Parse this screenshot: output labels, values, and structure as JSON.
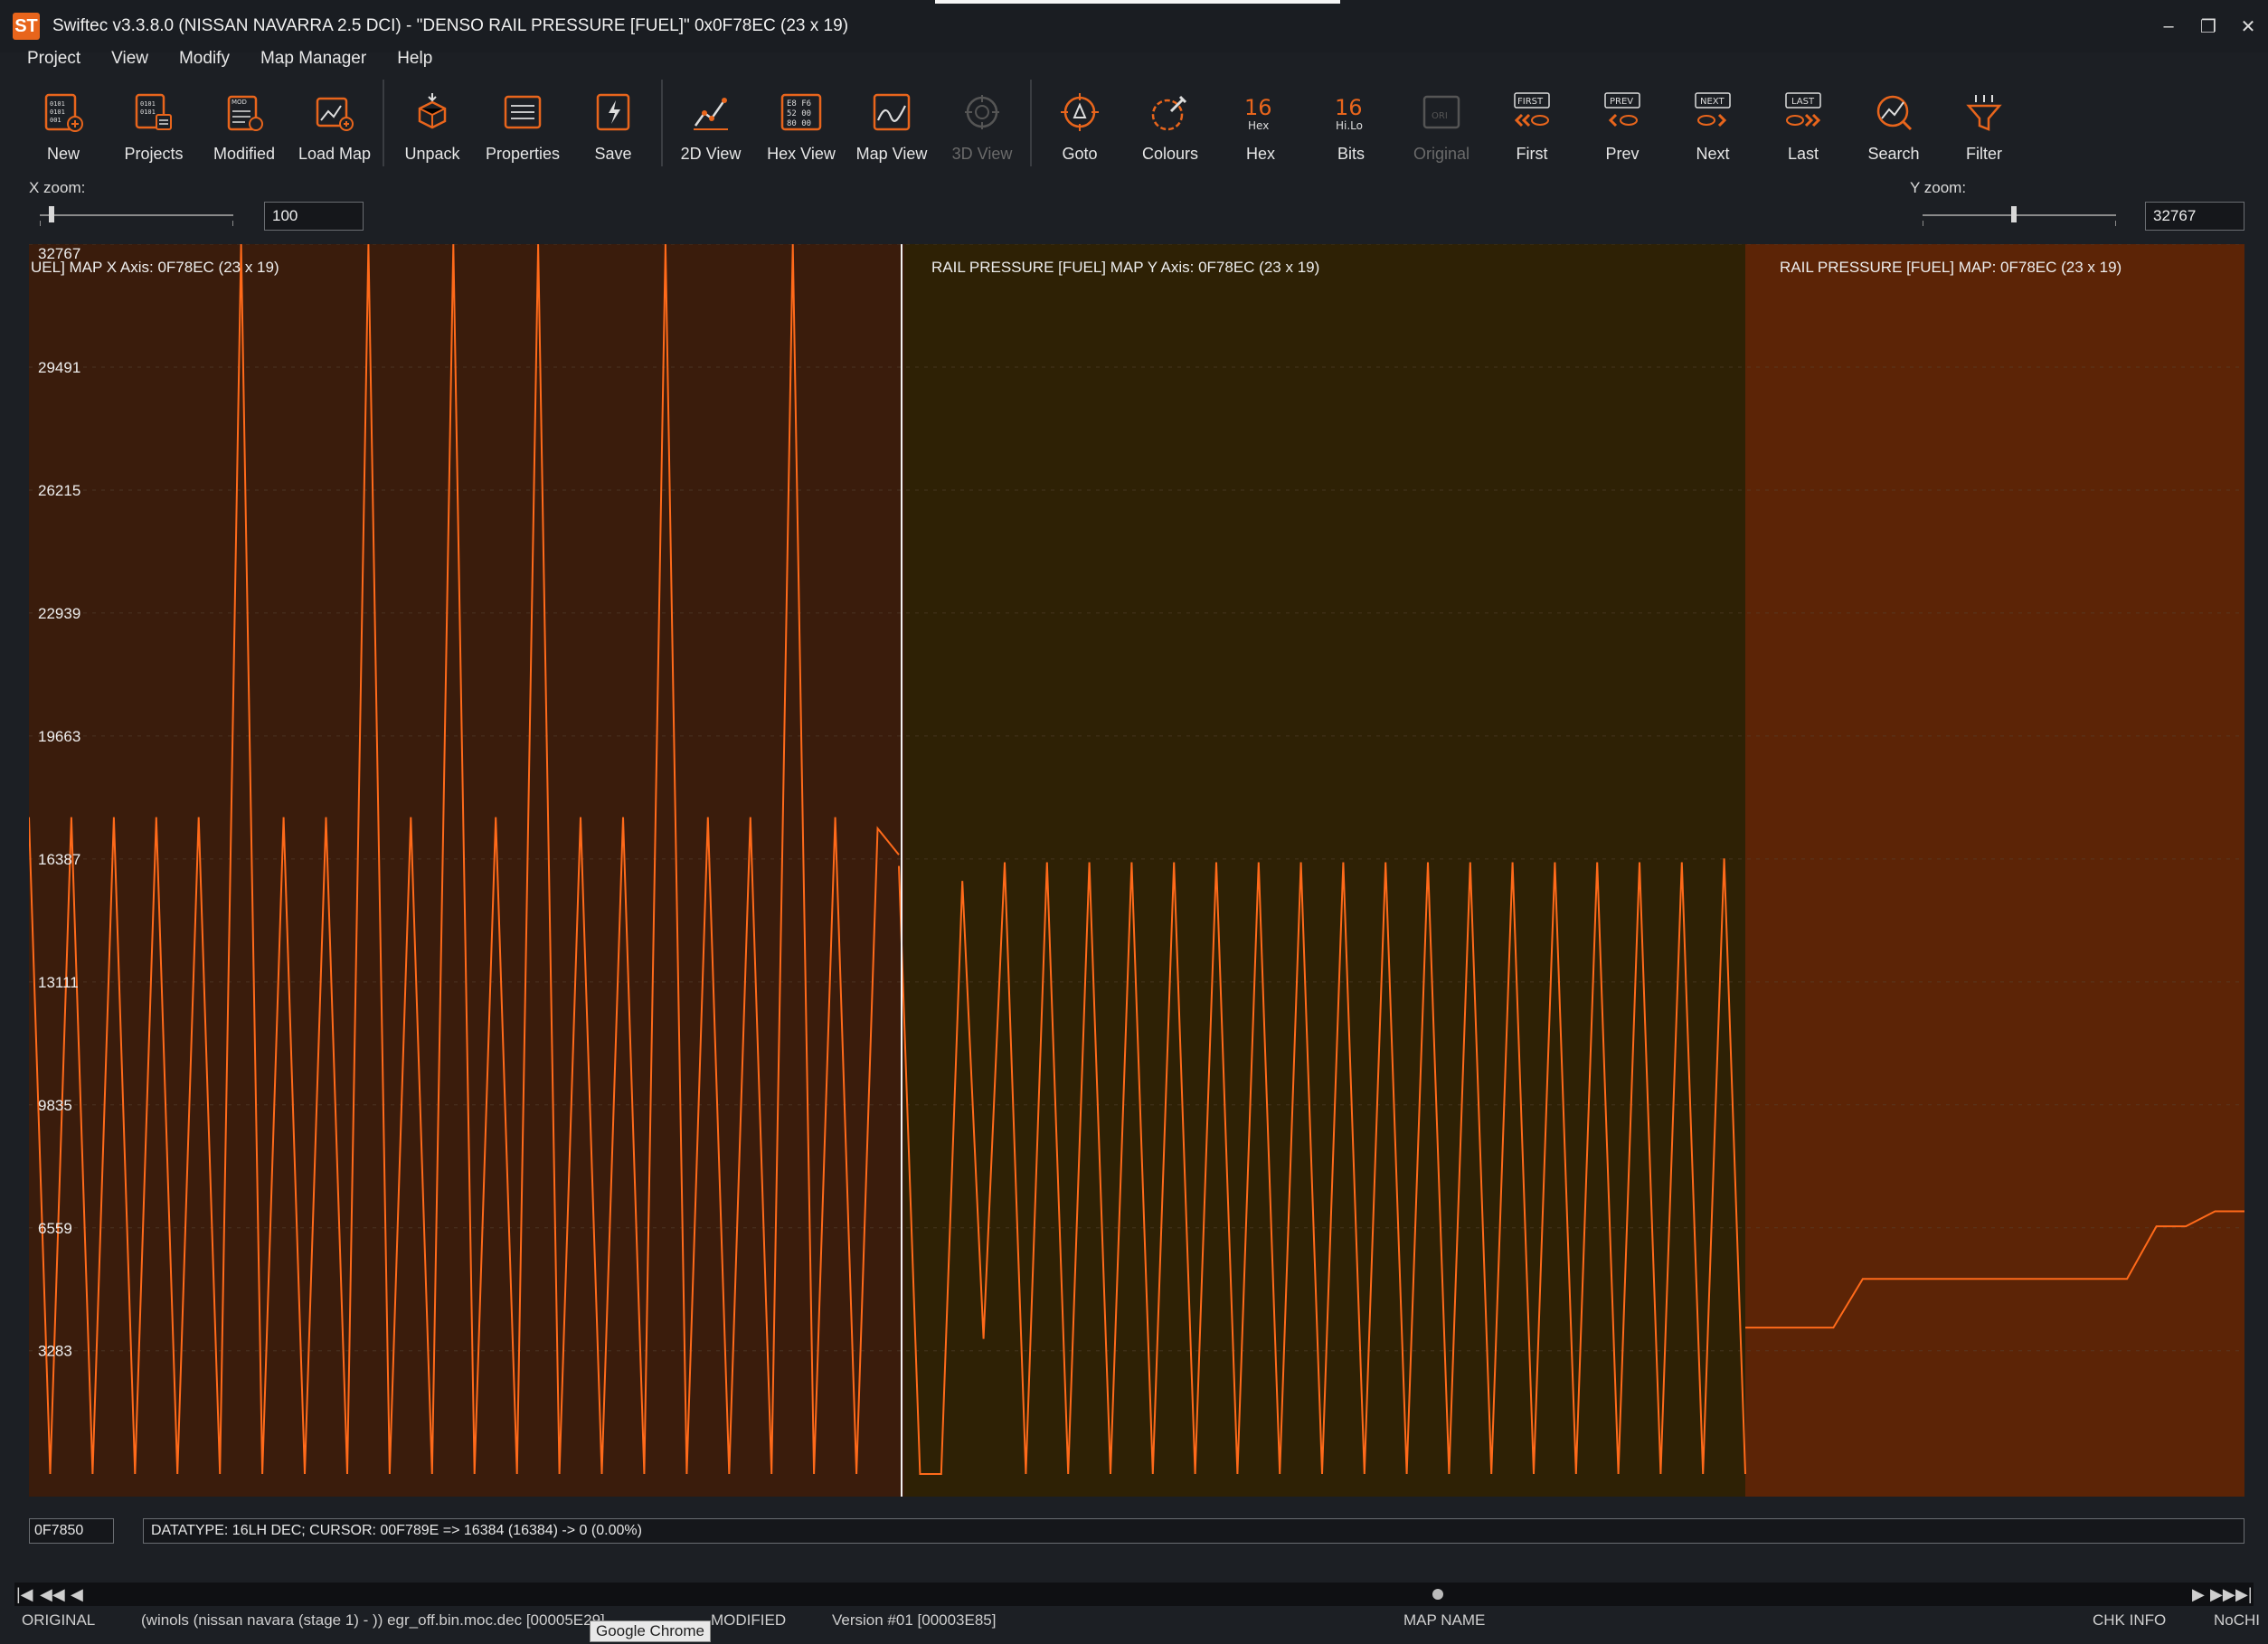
{
  "window": {
    "title": "Swiftec v3.3.8.0 (NISSAN NAVARRA 2.5 DCI) - \"DENSO RAIL PRESSURE [FUEL]\" 0x0F78EC (23 x 19)",
    "logo": "ST",
    "controls": {
      "minimize": "–",
      "restore": "❐",
      "close": "✕"
    }
  },
  "menu": [
    "Project",
    "View",
    "Modify",
    "Map Manager",
    "Help"
  ],
  "toolbar": [
    {
      "label": "New",
      "icon": "new-file-icon"
    },
    {
      "label": "Projects",
      "icon": "projects-icon"
    },
    {
      "label": "Modified",
      "icon": "modified-icon"
    },
    {
      "label": "Load Map",
      "icon": "load-map-icon"
    },
    {
      "label": "Unpack",
      "icon": "unpack-icon"
    },
    {
      "label": "Properties",
      "icon": "properties-icon"
    },
    {
      "label": "Save",
      "icon": "save-icon"
    },
    {
      "label": "2D View",
      "icon": "2d-view-icon"
    },
    {
      "label": "Hex View",
      "icon": "hex-view-icon"
    },
    {
      "label": "Map View",
      "icon": "map-view-icon"
    },
    {
      "label": "3D View",
      "icon": "3d-view-icon",
      "disabled": true
    },
    {
      "label": "Goto",
      "icon": "goto-icon"
    },
    {
      "label": "Colours",
      "icon": "colours-icon"
    },
    {
      "label": "Hex",
      "icon": "hex-icon"
    },
    {
      "label": "Bits",
      "icon": "bits-icon"
    },
    {
      "label": "Original",
      "icon": "original-icon",
      "disabled": true
    },
    {
      "label": "First",
      "icon": "first-icon"
    },
    {
      "label": "Prev",
      "icon": "prev-icon"
    },
    {
      "label": "Next",
      "icon": "next-icon"
    },
    {
      "label": "Last",
      "icon": "last-icon"
    },
    {
      "label": "Search",
      "icon": "search-icon"
    },
    {
      "label": "Filter",
      "icon": "filter-icon"
    }
  ],
  "icon_text": {
    "hex_top": "16",
    "hex_bottom": "Hex",
    "bits_top": "16",
    "bits_bottom": "Hi.Lo",
    "first": "FIRST",
    "prev": "PREV",
    "next": "NEXT",
    "last": "LAST",
    "hexview": [
      "E8 F6",
      "52 00",
      "80 00"
    ],
    "original": "ORI"
  },
  "zoom": {
    "x_label": "X zoom:",
    "x_value": "100",
    "x_level": 0.05,
    "y_label": "Y zoom:",
    "y_value": "32767",
    "y_level": 0.47
  },
  "chart_data": {
    "type": "line",
    "y_ticks": [
      32767,
      29491,
      26215,
      22939,
      19663,
      16387,
      13111,
      9835,
      6559,
      3283
    ],
    "ylim": [
      0,
      32767
    ],
    "regions": [
      {
        "label": "UEL] MAP X Axis: 0F78EC (23 x 19)",
        "color": "#3a1c0c"
      },
      {
        "label": "RAIL PRESSURE [FUEL] MAP Y Axis: 0F78EC (23 x 19)",
        "color": "#2e2105"
      },
      {
        "label": "RAIL PRESSURE [FUEL] MAP: 0F78EC (23 x 19)",
        "color": "#5c2406"
      }
    ],
    "series_color": "#ff6a1a",
    "x_axis_values": [
      17500,
      0,
      17500,
      0,
      17500,
      0,
      17500,
      0,
      17500,
      0,
      32767,
      0,
      17500,
      0,
      17500,
      0,
      32767,
      0,
      17500,
      0,
      32767,
      0,
      17500,
      0,
      32767,
      0,
      17500,
      0,
      17500,
      0,
      32767,
      0,
      17500,
      0,
      17500,
      0,
      32767,
      0,
      17500,
      0,
      17200,
      16500
    ],
    "y_axis_values": [
      16200,
      0,
      0,
      15800,
      3600,
      16300,
      0,
      16300,
      0,
      16300,
      0,
      16300,
      0,
      16300,
      0,
      16300,
      0,
      16300,
      0,
      16300,
      0,
      16300,
      0,
      16300,
      0,
      16300,
      0,
      16300,
      0,
      16300,
      0,
      16300,
      0,
      16300,
      0,
      16300,
      0,
      16300,
      0,
      16400,
      0
    ],
    "map_values": [
      3900,
      3900,
      3900,
      3900,
      5200,
      5200,
      5200,
      5200,
      5200,
      5200,
      5200,
      5200,
      5200,
      5200,
      6600,
      6600,
      7000,
      7000
    ]
  },
  "cursor": {
    "address": "0F7850"
  },
  "info": "DATATYPE: 16LH DEC;  CURSOR: 00F789E => 16384 (16384) -> 0 (0.00%)",
  "nav": {
    "first": "|◀",
    "prev_page": "◀◀",
    "prev": "◀",
    "next": "▶",
    "next_page": "▶▶",
    "last": "▶|"
  },
  "status": {
    "original": "ORIGINAL",
    "file": "(winols (nissan navara (stage 1) - )) egr_off.bin.moc.dec [00005E29]",
    "modified": "MODIFIED",
    "version": "Version #01 [00003E85]",
    "map_name": "MAP NAME",
    "chk_info": "CHK INFO",
    "nochk": "NoCHI",
    "tooltip": "Google Chrome"
  }
}
